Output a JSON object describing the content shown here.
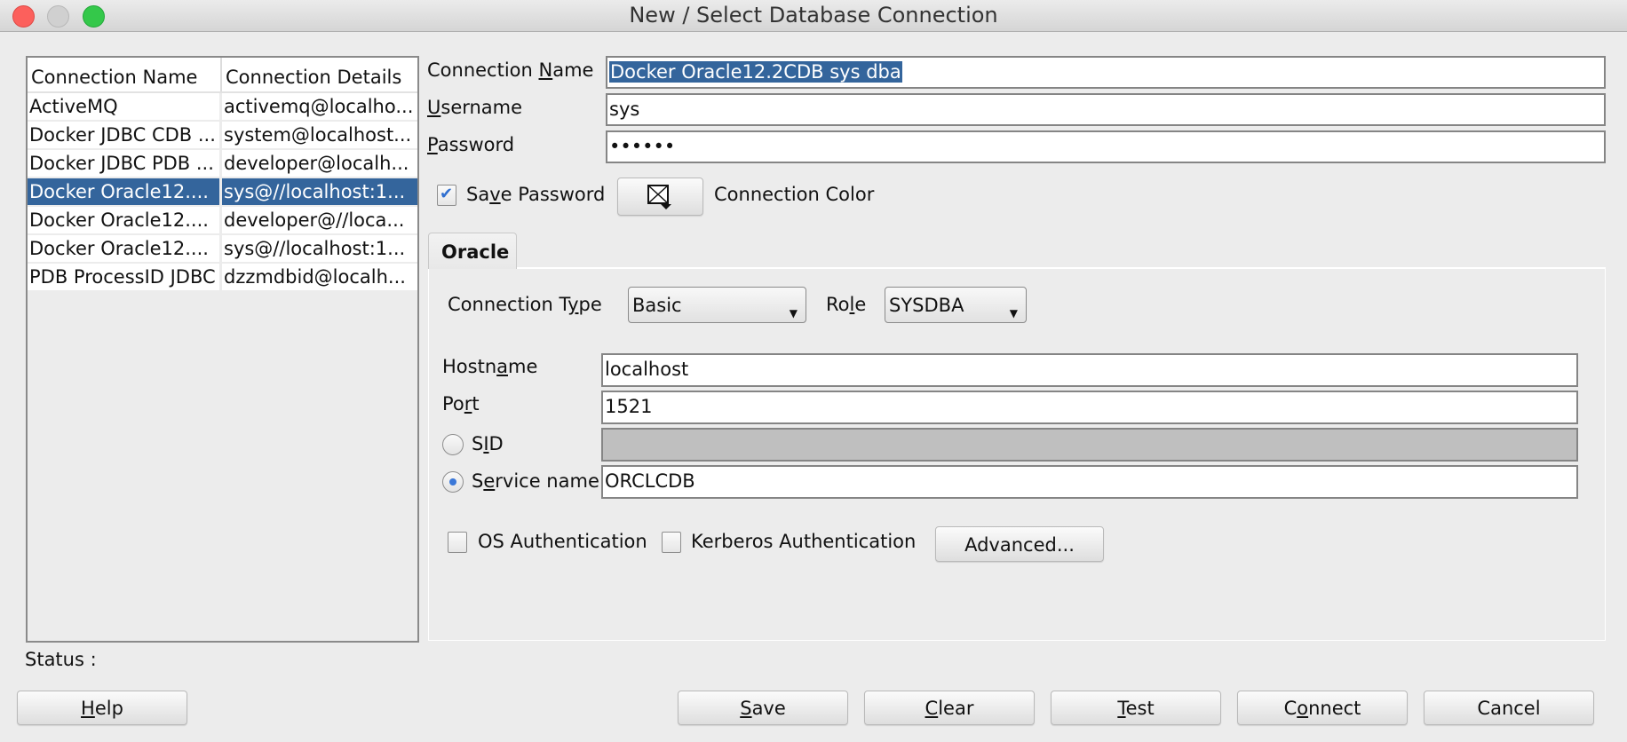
{
  "window": {
    "title": "New / Select Database Connection",
    "controls": [
      "close",
      "minimize",
      "zoom"
    ]
  },
  "connections_table": {
    "headers": [
      "Connection Name",
      "Connection Details"
    ],
    "rows": [
      {
        "name": "ActiveMQ",
        "details": "activemq@localho...",
        "selected": false
      },
      {
        "name": "Docker JDBC CDB ...",
        "details": "system@localhost...",
        "selected": false
      },
      {
        "name": "Docker JDBC PDB ...",
        "details": "developer@localh...",
        "selected": false
      },
      {
        "name": "Docker Oracle12....",
        "details": "sys@//localhost:1...",
        "selected": true
      },
      {
        "name": "Docker Oracle12....",
        "details": "developer@//loca...",
        "selected": false
      },
      {
        "name": "Docker Oracle12....",
        "details": "sys@//localhost:1...",
        "selected": false
      },
      {
        "name": "PDB ProcessID JDBC",
        "details": "dzzmdbid@localh...",
        "selected": false
      }
    ]
  },
  "form": {
    "connection_name": {
      "label_pre": "Connection ",
      "label_u": "N",
      "label_post": "ame",
      "value": "Docker Oracle12.2CDB sys dba"
    },
    "username": {
      "label_pre": "",
      "label_u": "U",
      "label_post": "sername",
      "value": "sys"
    },
    "password": {
      "label_pre": "",
      "label_u": "P",
      "label_post": "assword",
      "value": "••••••"
    },
    "save_password": {
      "label_pre": "Sa",
      "label_u": "v",
      "label_post": "e Password",
      "checked": true
    },
    "connection_color": {
      "label": "Connection Color",
      "icon": "color-picker-icon"
    }
  },
  "tabs": [
    {
      "label": "Oracle",
      "active": true
    }
  ],
  "oracle": {
    "connection_type": {
      "label_pre": "Connection T",
      "label_u": "y",
      "label_post": "pe",
      "value": "Basic"
    },
    "role": {
      "label_pre": "Ro",
      "label_u": "l",
      "label_post": "e",
      "value": "SYSDBA"
    },
    "hostname": {
      "label_pre": "Hostn",
      "label_u": "a",
      "label_post": "me",
      "value": "localhost"
    },
    "port": {
      "label_pre": "Po",
      "label_u": "r",
      "label_post": "t",
      "value": "1521"
    },
    "sid": {
      "label_pre": "S",
      "label_u": "I",
      "label_post": "D",
      "value": "",
      "selected": false,
      "enabled": false
    },
    "service_name": {
      "label_pre": "S",
      "label_u": "e",
      "label_post": "rvice name",
      "value": "ORCLCDB",
      "selected": true
    },
    "os_auth": {
      "label": "OS Authentication",
      "checked": false
    },
    "kerberos_auth": {
      "label": "Kerberos Authentication",
      "checked": false
    },
    "advanced_button": "Advanced..."
  },
  "status": {
    "label": "Status :",
    "value": ""
  },
  "buttons": {
    "help": {
      "u": "H",
      "rest": "elp"
    },
    "save": {
      "u": "S",
      "rest": "ave"
    },
    "clear": {
      "u": "C",
      "rest": "lear"
    },
    "test": {
      "u": "T",
      "rest": "est"
    },
    "connect": {
      "pre": "C",
      "u": "o",
      "rest": "nnect"
    },
    "cancel": {
      "label": "Cancel"
    }
  }
}
